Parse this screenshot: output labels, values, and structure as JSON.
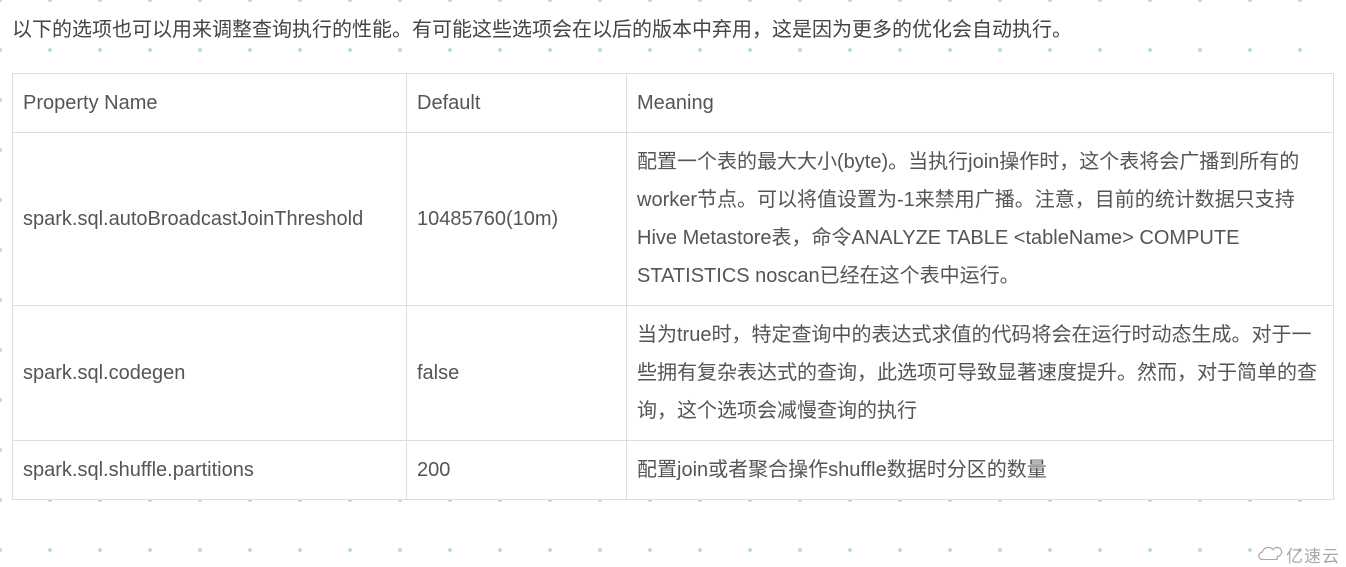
{
  "intro": "以下的选项也可以用来调整查询执行的性能。有可能这些选项会在以后的版本中弃用，这是因为更多的优化会自动执行。",
  "columns": {
    "property": "Property Name",
    "default": "Default",
    "meaning": "Meaning"
  },
  "rows": [
    {
      "property": "spark.sql.autoBroadcastJoinThreshold",
      "default": "10485760(10m)",
      "meaning": "配置一个表的最大大小(byte)。当执行join操作时，这个表将会广播到所有的worker节点。可以将值设置为-1来禁用广播。注意，目前的统计数据只支持Hive Metastore表，命令ANALYZE TABLE <tableName> COMPUTE STATISTICS noscan已经在这个表中运行。"
    },
    {
      "property": "spark.sql.codegen",
      "default": "false",
      "meaning": "当为true时，特定查询中的表达式求值的代码将会在运行时动态生成。对于一些拥有复杂表达式的查询，此选项可导致显著速度提升。然而，对于简单的查询，这个选项会减慢查询的执行"
    },
    {
      "property": "spark.sql.shuffle.partitions",
      "default": "200",
      "meaning": "配置join或者聚合操作shuffle数据时分区的数量"
    }
  ],
  "watermark": "亿速云"
}
